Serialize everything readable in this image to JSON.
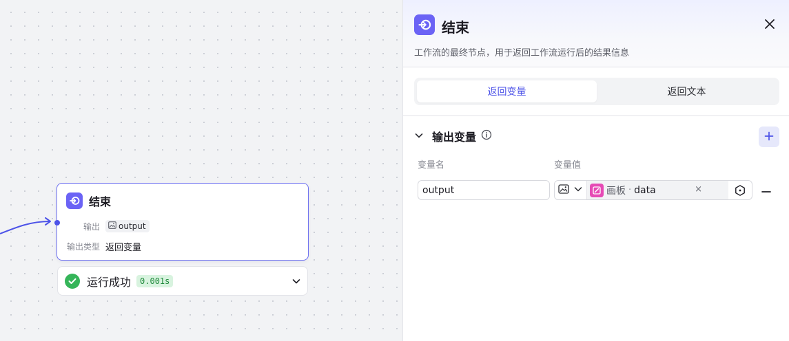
{
  "canvas": {
    "node": {
      "title": "结束",
      "output_label": "输出",
      "output_value": "output",
      "output_type_label": "输出类型",
      "output_type_value": "返回变量"
    },
    "run_status": {
      "text": "运行成功",
      "duration": "0.001s"
    }
  },
  "panel": {
    "title": "结束",
    "description": "工作流的最终节点，用于返回工作流运行后的结果信息",
    "tabs": [
      {
        "label": "返回变量",
        "active": true
      },
      {
        "label": "返回文本",
        "active": false
      }
    ],
    "section": {
      "title": "输出变量",
      "col_name": "变量名",
      "col_value": "变量值"
    },
    "row": {
      "name_value": "output",
      "ref_node": "画板",
      "ref_sep": "·",
      "ref_var": "data",
      "clear_symbol": "×"
    }
  },
  "colors": {
    "accent": "#4d53e8",
    "node_icon": "#6b63f5",
    "success": "#35b559",
    "ref_icon": "#e64ab5"
  },
  "icons": [
    "end-node-icon",
    "image-type-icon",
    "check-icon",
    "chevron-down-icon",
    "close-icon",
    "info-icon",
    "plus-icon",
    "minus-icon",
    "variable-picker-icon",
    "canvas-node-icon"
  ]
}
